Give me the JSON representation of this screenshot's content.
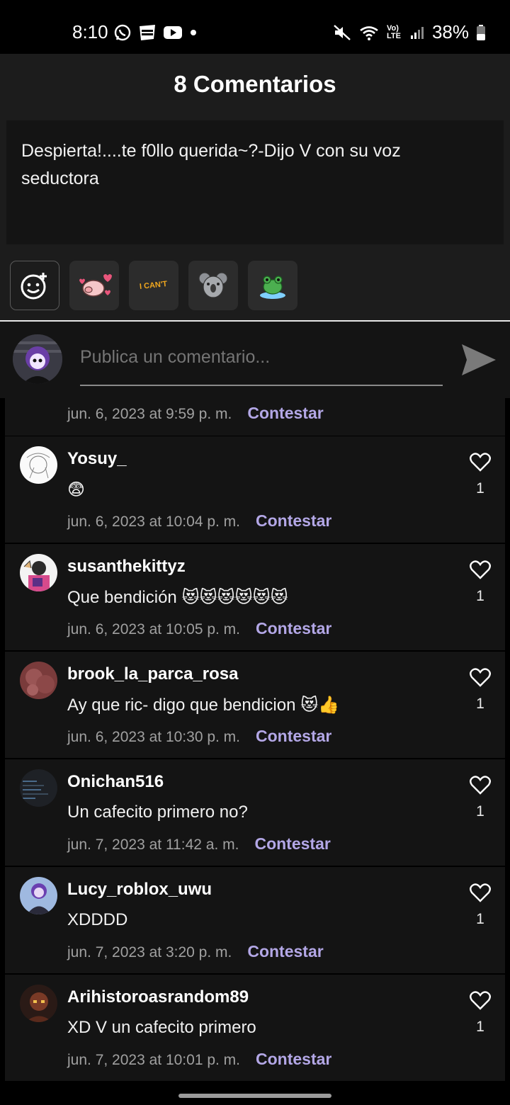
{
  "status_bar": {
    "time": "8:10",
    "battery": "38%",
    "network": "Vo) LTE",
    "left_icons": [
      "whatsapp-icon",
      "webtoon-icon",
      "youtube-icon",
      "dot-icon"
    ],
    "right_icons": [
      "mute-icon",
      "wifi-icon",
      "signal-icon",
      "battery-icon"
    ]
  },
  "header": {
    "title": "8 Comentarios",
    "quote": "Despierta!....te f0llo querida~?-Dijo V con su voz seductora"
  },
  "stickers": [
    {
      "name": "add-emoji-icon"
    },
    {
      "name": "pig-sticker"
    },
    {
      "name": "i-cant-sticker",
      "text": "I CAN'T"
    },
    {
      "name": "koala-sticker"
    },
    {
      "name": "frog-sticker"
    }
  ],
  "composer": {
    "placeholder": "Publica un comentario..."
  },
  "comments": {
    "partial": {
      "date": "jun. 6, 2023 at 9:59 p. m.",
      "reply": "Contestar"
    },
    "items": [
      {
        "user": "Yosuy_",
        "text": "😨",
        "date": "jun. 6, 2023 at 10:04 p. m.",
        "reply": "Contestar",
        "likes": "1"
      },
      {
        "user": "susanthekittyz",
        "text": "Que bendición 😻😻😻😻😻😻",
        "date": "jun. 6, 2023 at 10:05 p. m.",
        "reply": "Contestar",
        "likes": "1"
      },
      {
        "user": "brook_la_parca_rosa",
        "text": "Ay que ric- digo que bendicion 😻👍",
        "date": "jun. 6, 2023 at 10:30 p. m.",
        "reply": "Contestar",
        "likes": "1"
      },
      {
        "user": "Onichan516",
        "text": "Un cafecito primero no?",
        "date": "jun. 7, 2023 at 11:42 a. m.",
        "reply": "Contestar",
        "likes": "1"
      },
      {
        "user": "Lucy_roblox_uwu",
        "text": "XDDDD",
        "date": "jun. 7, 2023 at 3:20 p. m.",
        "reply": "Contestar",
        "likes": "1"
      },
      {
        "user": "Arihistoroasrandom89",
        "text": "XD V un cafecito primero",
        "date": "jun. 7, 2023 at 10:01 p. m.",
        "reply": "Contestar",
        "likes": "1"
      }
    ]
  },
  "colors": {
    "accent": "#b3a7e6",
    "panel": "#141414",
    "header_bg": "#1c1c1c"
  }
}
